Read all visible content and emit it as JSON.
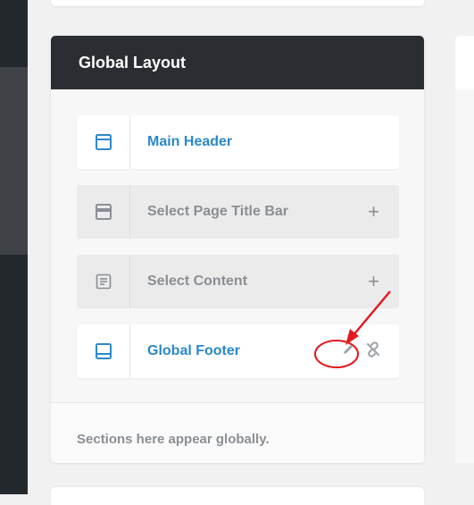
{
  "card": {
    "title": "Global Layout",
    "footer_note": "Sections here appear globally."
  },
  "sections": [
    {
      "label": "Main Header",
      "state": "assigned",
      "icon": "header-layout-icon"
    },
    {
      "label": "Select Page Title Bar",
      "state": "empty",
      "icon": "title-bar-layout-icon",
      "action": "+"
    },
    {
      "label": "Select Content",
      "state": "empty",
      "icon": "content-layout-icon",
      "action": "+"
    },
    {
      "label": "Global Footer",
      "state": "assigned",
      "icon": "footer-layout-icon",
      "actions": [
        "edit-icon",
        "unlink-icon"
      ]
    }
  ],
  "colors": {
    "accent": "#2a89c9",
    "header_bg": "#2a2e33",
    "annotation": "#e2191f"
  }
}
